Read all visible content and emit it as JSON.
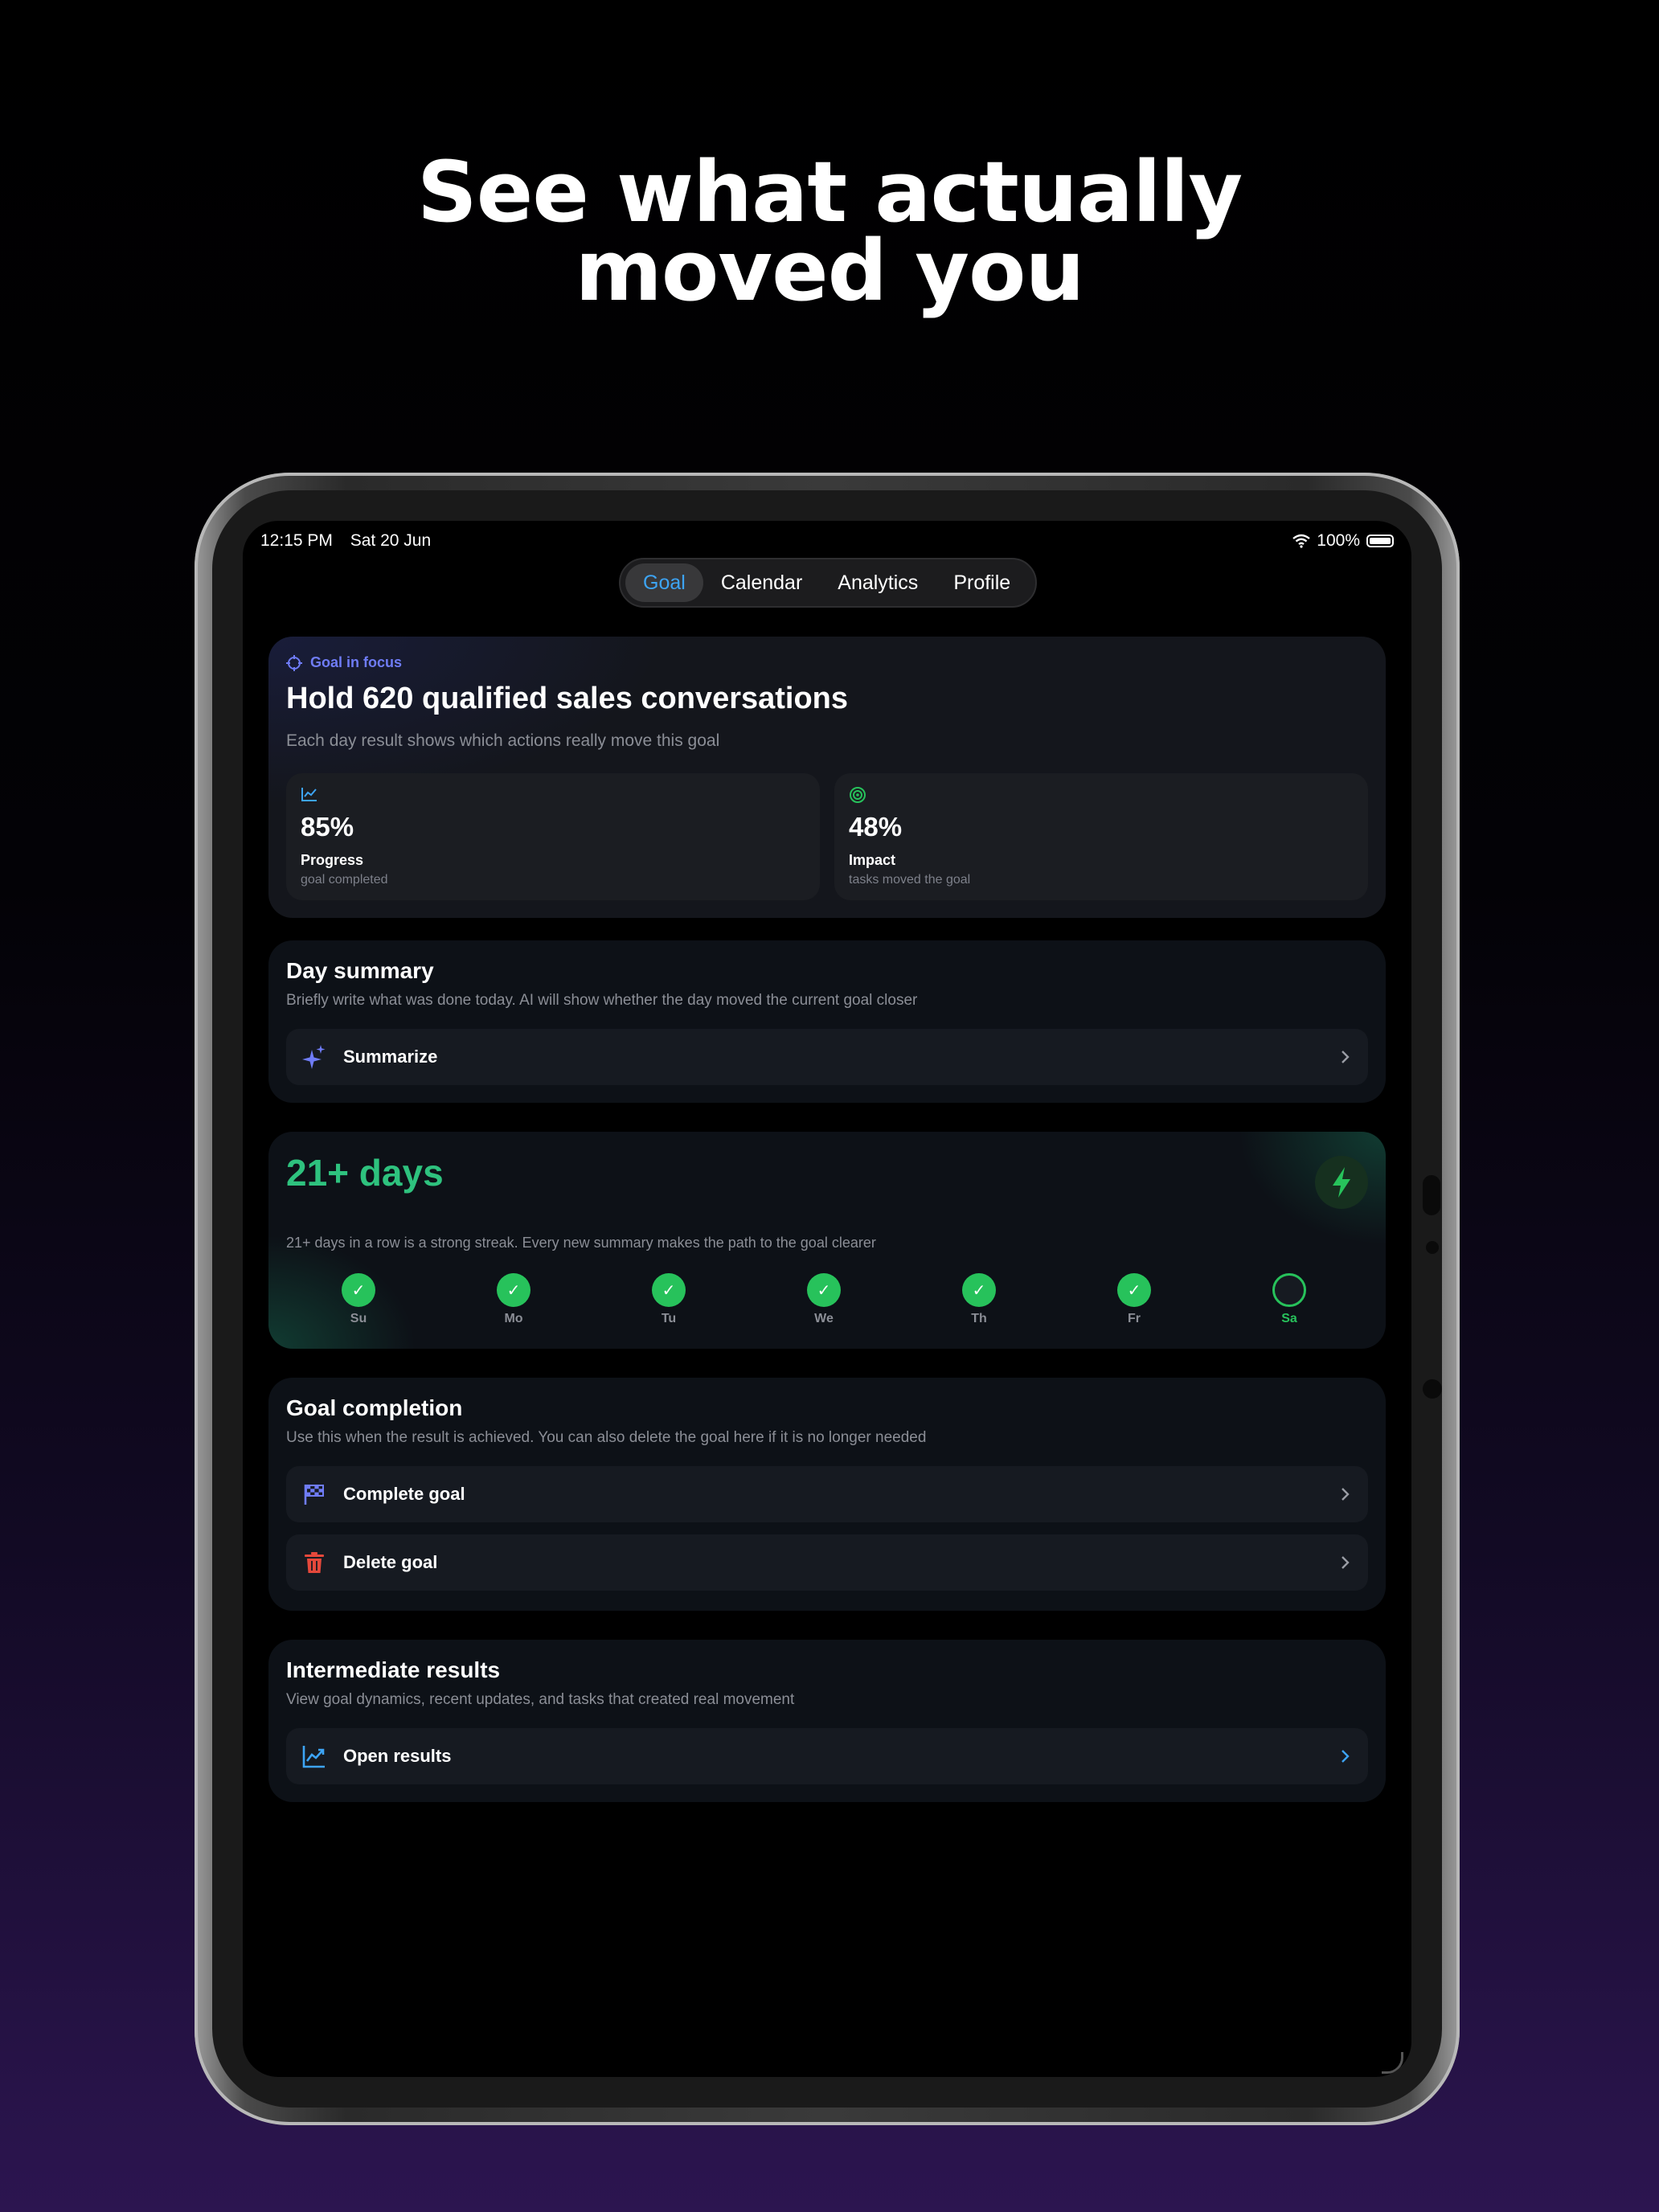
{
  "headline": {
    "line1": "See what actually",
    "line2": "moved you"
  },
  "status_bar": {
    "time": "12:15 PM",
    "date": "Sat 20 Jun",
    "battery": "100%"
  },
  "tabs": [
    {
      "label": "Goal",
      "active": true
    },
    {
      "label": "Calendar",
      "active": false
    },
    {
      "label": "Analytics",
      "active": false
    },
    {
      "label": "Profile",
      "active": false
    }
  ],
  "focus": {
    "label": "Goal in focus",
    "title": "Hold 620 qualified sales conversations",
    "description": "Each day result shows which actions really move this goal",
    "progress": {
      "value": "85%",
      "label": "Progress",
      "sub": "goal completed"
    },
    "impact": {
      "value": "48%",
      "label": "Impact",
      "sub": "tasks moved the goal"
    }
  },
  "summary": {
    "title": "Day summary",
    "description": "Briefly write what was done today. AI will show whether the day moved the current goal closer",
    "button": "Summarize"
  },
  "streak": {
    "title": "21+ days",
    "description": "21+ days in a row is a strong streak. Every new summary makes the path to the goal clearer",
    "days": [
      {
        "label": "Su",
        "done": true,
        "mark": "✓"
      },
      {
        "label": "Mo",
        "done": true,
        "mark": "✓"
      },
      {
        "label": "Tu",
        "done": true,
        "mark": "✓"
      },
      {
        "label": "We",
        "done": true,
        "mark": "✓"
      },
      {
        "label": "Th",
        "done": true,
        "mark": "✓"
      },
      {
        "label": "Fr",
        "done": true,
        "mark": "✓"
      },
      {
        "label": "Sa",
        "done": false,
        "mark": ""
      }
    ]
  },
  "completion": {
    "title": "Goal completion",
    "description": "Use this when the result is achieved. You can also delete the goal here if it is no longer needed",
    "complete_button": "Complete goal",
    "delete_button": "Delete goal"
  },
  "results": {
    "title": "Intermediate results",
    "description": "View goal dynamics, recent updates, and tasks that created real movement",
    "button": "Open results"
  },
  "colors": {
    "accent_blue": "#3da4f5",
    "accent_indigo": "#6f7cf6",
    "streak_green": "#27c25b",
    "danger_red": "#e5483b"
  },
  "icons": {
    "focus": "crosshair-icon",
    "progress": "line-chart-icon",
    "impact": "target-icon",
    "summarize": "sparkle-icon",
    "streak": "lightning-bolt-icon",
    "complete": "checkered-flag-icon",
    "delete": "trash-icon",
    "results": "trend-chart-icon",
    "chevron": "chevron-right-icon"
  }
}
